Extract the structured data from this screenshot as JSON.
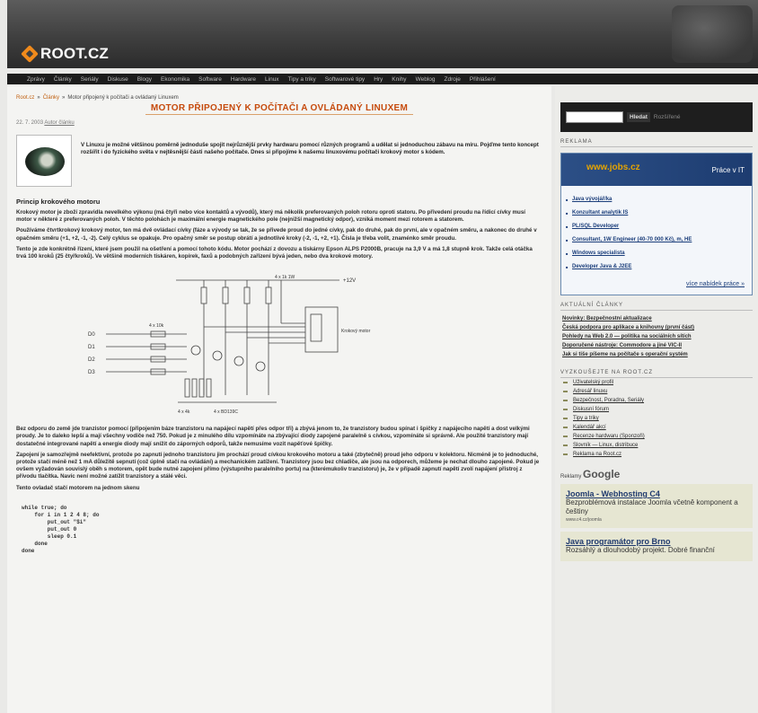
{
  "header": {
    "logo": "ROOT.CZ",
    "nav": [
      "Zprávy",
      "Články",
      "Seriály",
      "Diskuse",
      "Blogy",
      "Ekonomika",
      "Software",
      "Hardware",
      "Linux",
      "Tipy a triky",
      "Softwarové tipy",
      "Hry",
      "Knihy",
      "Weblog",
      "Zdroje",
      "Přihlášení"
    ]
  },
  "article": {
    "breadcrumb": [
      "Root.cz",
      "Články",
      "Motor připojený k počítači a ovládaný Linuxem"
    ],
    "title": "Motor připojený k počítači a ovládaný Linuxem",
    "meta_date": "22. 7. 2003",
    "meta_author": "Autor článku",
    "lead": "V Linuxu je možné většinou poměrně jednoduše spojit nejrůznější prvky hardwaru pomocí různých programů a udělat si jednoduchou zábavu na míru. Pojďme tento koncept rozšířit i do fyzického světa v nejtěsnější části našeho počítače. Dnes si připojíme k našemu linuxovému počítači krokový motor s kódem.",
    "section_heading": "Princip krokového motoru",
    "p1": "Krokový motor je zboží zpravidla nevelkého výkonu (má čtyři nebo více kontaktů a vývodů), který má několik preferovaných poloh rotoru oproti statoru. Po přivedení proudu na řídicí cívky musí motor v některé z preferovaných poloh. V těchto polohách je maximální energie magnetického pole (nejnižší magnetický odpor), vzniká moment mezi rotorem a statorem.",
    "p2": "Používáme čtvrtkrokový krokový motor, ten má dvě ovládací cívky (fáze a vývody se tak, že se přivede proud do jedné cívky, pak do druhé, pak do první, ale v opačném směru, a nakonec do druhé v opačném směru (+1, +2, -1, -2). Celý cyklus se opakuje. Pro opačný směr se postup obrátí a jednotlivé kroky (-2, -1, +2, +1). Čísla je třeba volit, znaménko směr proudu.",
    "p3": "Tento je zde konkrétně řízení, které jsem použil na ošetření a pomocí tohoto kódu. Motor pochází z dovozu a tiskárny Epson ALPS P2000B, pracuje na 3,9 V a má 1,8 stupně krok. Takže celá otáčka trvá 100 kroků (25 čtyřkroků). Ve většině moderních tiskáren, kopírek, faxů a podobných zařízení bývá jeden, nebo dva krokové motory.",
    "p4": "Bez odporu do země jde tranzistor pomocí (připojením báze tranzistoru na napájecí napětí přes odpor tři) a zbývá jenom to, že tranzistory budou spínat i špičky z napájecího napětí a dost velkými proudy. Je to daleko lepší a mají všechny vodiče než 750. Pokud je z minulého dílu vzpomínáte na zbývající diody zapojené paralelně s cívkou, vzpomínáte si správně. Ale použité tranzistory mají dostatečné integrované napětí a energie diody mají snížit do záporných odporů, takže nemusíme vozit napěťové špičky.",
    "p5": "Zapojení je samozřejmě neefektivní, protože po zapnutí jednoho tranzistoru jim prochází proud cívkou krokového motoru a také (zbytečně) proud jeho odporu v kolektoru. Nicméně je to jednoduché, protože stačí méně než 1 mA důležitě sepnutí (což úplně stačí na ovládání) a mechanickém zatížení. Tranzistory jsou bez chladiče, ale jsou na odporech, můžeme je nechat dlouho zapojené. Pokud je ovšem vyžadován souvislý oběh s motorem, opět bude nutné zapojení přímo (výstupního paralelního portu) na (kterémukoliv tranzistoru) je, že v případě zapnutí napětí zvolí napájení přístroj z přívodu tlačítka. Navíc není možné zatížit tranzistory a stálé věci.",
    "p6": "Tento ovladač stačí motorem na jednom skenu",
    "code": "while true; do\n    for i in 1 2 4 8; do\n        put_out \"$i\"\n        put_out 0\n        sleep 0.1\n    done\ndone"
  },
  "diagram": {
    "vcc": "+12V",
    "inputs": [
      "D0",
      "D1",
      "D2",
      "D3"
    ],
    "resistors": "4 x 10k",
    "motor": "Krokový motor",
    "bottom": [
      "4 x 4k",
      "4 x BD139C"
    ],
    "top_resistors": "4 x 1k 1W"
  },
  "sidebar": {
    "search_placeholder": "",
    "search_btn": "Hledat",
    "search_alt": "Rozšířené",
    "reklama": "Reklama",
    "jobs_www": "www.jobs.cz",
    "jobs_prace": "Práce v IT",
    "jobs": [
      "Java vývojář/ka",
      "Konzultant analytik IS",
      "PL/SQL Developer",
      "Consultant, 1W Engineer (40-70 000 Kč), m, HE",
      "Windows specialista",
      "Developer Java & J2EE"
    ],
    "jobs_more": "více nabídek práce »",
    "aktualni_h": "Aktuální články",
    "aktualni": [
      "Novinky: Bezpečnostní aktualizace",
      "Česká podpora pro aplikace a knihovny (první část)",
      "Pohledy na Web 2.0 — politika na sociálních sítích",
      "Doporučené nástroje: Commodore a jiné VIC-II",
      "Jak si tiše píšeme na počítače s operační systém"
    ],
    "vyzkousejte_h": "Vyzkoušejte na Root.cz",
    "vyzkousejte": [
      "Uživatelský profil",
      "Adresář linuxu",
      "Bezpečnost, Poradna, Seriály",
      "Diskusní fórum",
      "Tipy a triky",
      "Kalendář akcí",
      "Recenze hardwaru (Sponzoři)",
      "Slovník — Linux, distribuce",
      "Reklama na Root.cz"
    ],
    "ads_label": "Reklamy",
    "ads_brand": "Google",
    "ads": [
      {
        "title": "Joomla - Webhosting C4",
        "body": "Bezproblémová instalace Joomla včetně komponent a češtiny",
        "url": "www.c4.cz/joomla"
      },
      {
        "title": "Java programátor pro Brno",
        "body": "Rozsáhlý a dlouhodobý projekt. Dobré finanční",
        "url": ""
      }
    ]
  }
}
